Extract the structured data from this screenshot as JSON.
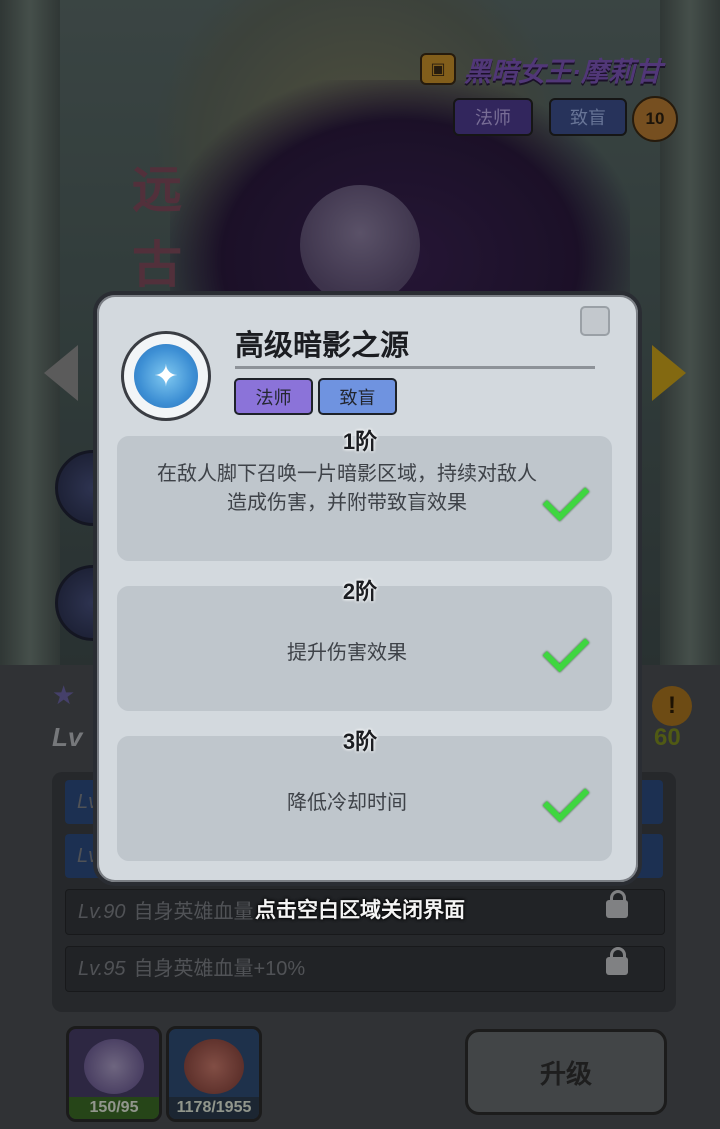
{
  "hero": {
    "name": "黑暗女王·摩莉甘",
    "tags": [
      "法师",
      "致盲"
    ],
    "level_badge": "10",
    "side_title_1": "远",
    "side_title_2": "古"
  },
  "panel": {
    "level_prefix": "Lv",
    "right_number": "60",
    "rows": [
      {
        "level": "Lv",
        "text": "",
        "state": "unlocked"
      },
      {
        "level": "Lv",
        "text": "",
        "state": "unlocked"
      },
      {
        "level": "Lv.90",
        "text": "自身英雄血量",
        "state": "locked"
      },
      {
        "level": "Lv.95",
        "text": "自身英雄血量+10%",
        "state": "locked"
      }
    ],
    "items": [
      {
        "name": "hero-fragment",
        "count": "150/95"
      },
      {
        "name": "meat",
        "count": "1178/1955"
      }
    ],
    "upgrade_label": "升级"
  },
  "modal": {
    "skill_name": "高级暗影之源",
    "tags": [
      "法师",
      "致盲"
    ],
    "tiers": [
      {
        "label": "1阶",
        "description": "在敌人脚下召唤一片暗影区域，持续对敌人造成伤害，并附带致盲效果",
        "completed": true
      },
      {
        "label": "2阶",
        "description": "提升伤害效果",
        "completed": true
      },
      {
        "label": "3阶",
        "description": "降低冷却时间",
        "completed": true
      }
    ],
    "close_hint": "点击空白区域关闭界面"
  },
  "colors": {
    "accent_purple": "#8b73d9",
    "accent_blue": "#6f93e0",
    "check_green": "#3fd640"
  }
}
